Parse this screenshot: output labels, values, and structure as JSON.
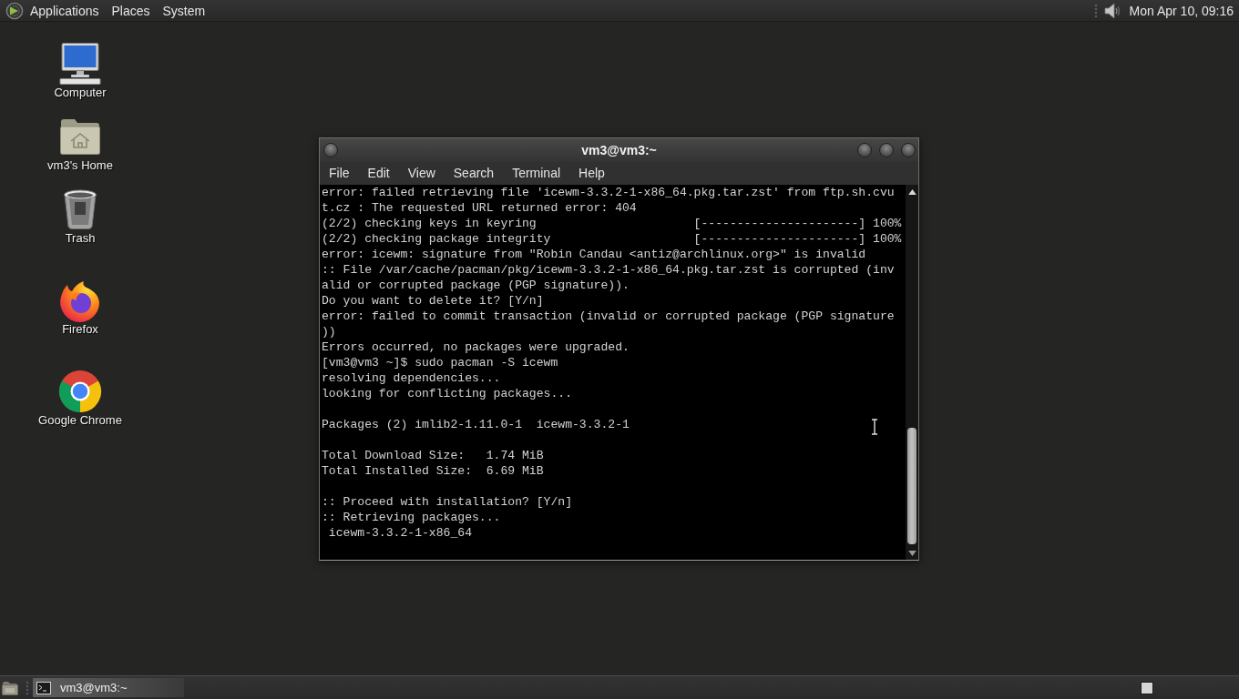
{
  "top_panel": {
    "menus": [
      "Applications",
      "Places",
      "System"
    ],
    "clock": "Mon Apr 10, 09:16"
  },
  "desktop_icons": [
    {
      "kind": "computer",
      "label": "Computer"
    },
    {
      "kind": "home",
      "label": "vm3's Home"
    },
    {
      "kind": "trash",
      "label": "Trash"
    },
    {
      "kind": "firefox",
      "label": "Firefox"
    },
    {
      "kind": "chrome",
      "label": "Google Chrome"
    }
  ],
  "terminal_window": {
    "title": "vm3@vm3:~",
    "menu": [
      "File",
      "Edit",
      "View",
      "Search",
      "Terminal",
      "Help"
    ],
    "output_blocks": [
      [
        "error: failed retrieving file 'icewm-3.3.2-1-x86_64.pkg.tar.zst' from ftp.sh.cvu",
        "t.cz : The requested URL returned error: 404",
        "(2/2) checking keys in keyring                      [----------------------] 100%",
        "(2/2) checking package integrity                    [----------------------] 100%",
        "error: icewm: signature from \"Robin Candau <antiz@archlinux.org>\" is invalid",
        ":: File /var/cache/pacman/pkg/icewm-3.3.2-1-x86_64.pkg.tar.zst is corrupted (inv",
        "alid or corrupted package (PGP signature)).",
        "Do you want to delete it? [Y/n]",
        "error: failed to commit transaction (invalid or corrupted package (PGP signature",
        "))",
        "Errors occurred, no packages were upgraded.",
        "[vm3@vm3 ~]$ sudo pacman -S icewm",
        "resolving dependencies...",
        "looking for conflicting packages..."
      ],
      [
        "Packages (2) imlib2-1.11.0-1  icewm-3.3.2-1"
      ],
      [
        "Total Download Size:   1.74 MiB",
        "Total Installed Size:  6.69 MiB"
      ],
      [
        ":: Proceed with installation? [Y/n]",
        ":: Retrieving packages...",
        " icewm-3.3.2-1-x86_64"
      ]
    ]
  },
  "bottom_panel": {
    "tasks": [
      {
        "label": "vm3@vm3:~",
        "selected": true
      }
    ]
  }
}
